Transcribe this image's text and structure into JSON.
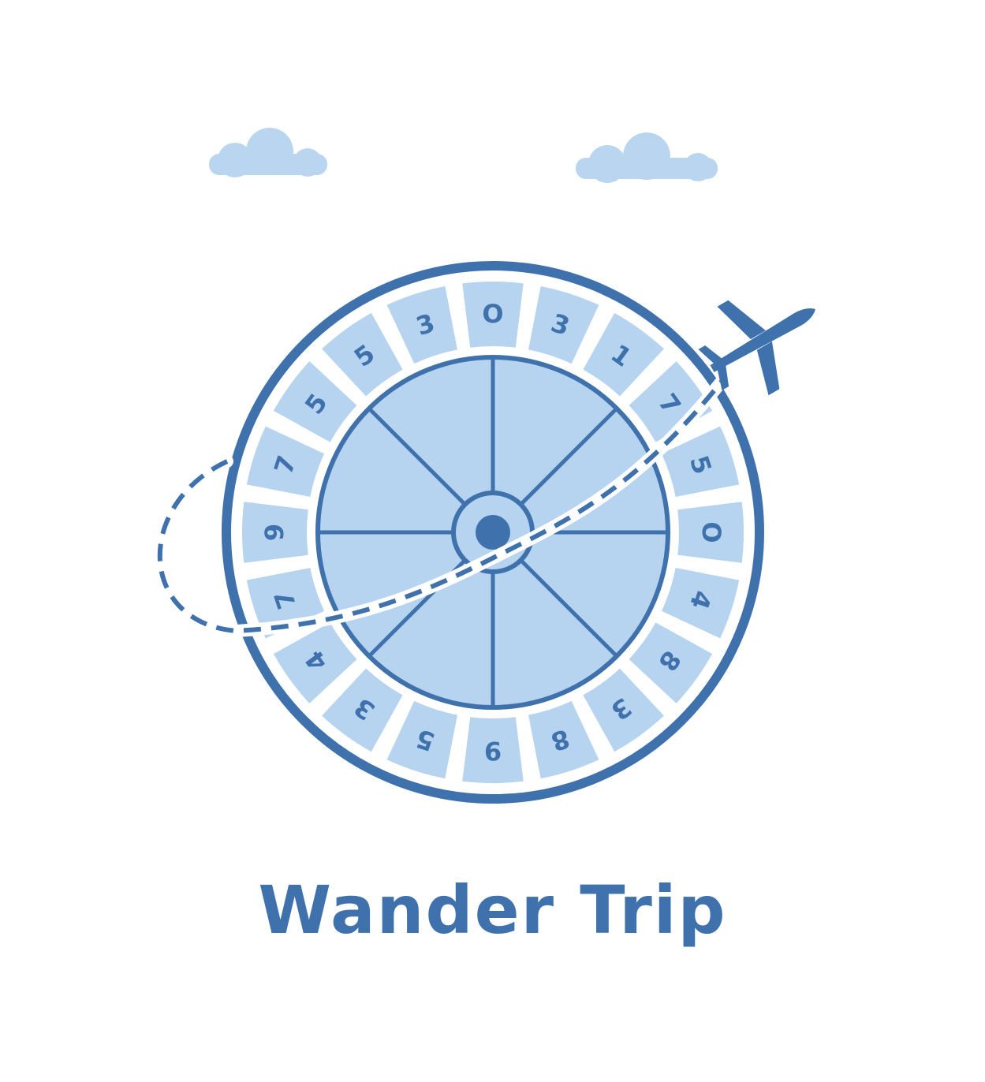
{
  "brand": {
    "name": "Wander Trip"
  },
  "colors": {
    "primary": "#3f72ad",
    "light": "#b6d3ef",
    "cloud": "#b9d5f0",
    "background": "#ffffff"
  },
  "icons": [
    "cloud-icon",
    "cloud-icon",
    "roulette-wheel-icon",
    "airplane-icon",
    "dashed-flight-path"
  ],
  "wheel": {
    "pockets": [
      "O",
      "3",
      "1",
      "7",
      "5",
      "O",
      "4",
      "8",
      "3",
      "8",
      "9",
      "5",
      "3",
      "4",
      "7",
      "9",
      "7",
      "5",
      "5",
      "3"
    ],
    "spokes": 8
  }
}
